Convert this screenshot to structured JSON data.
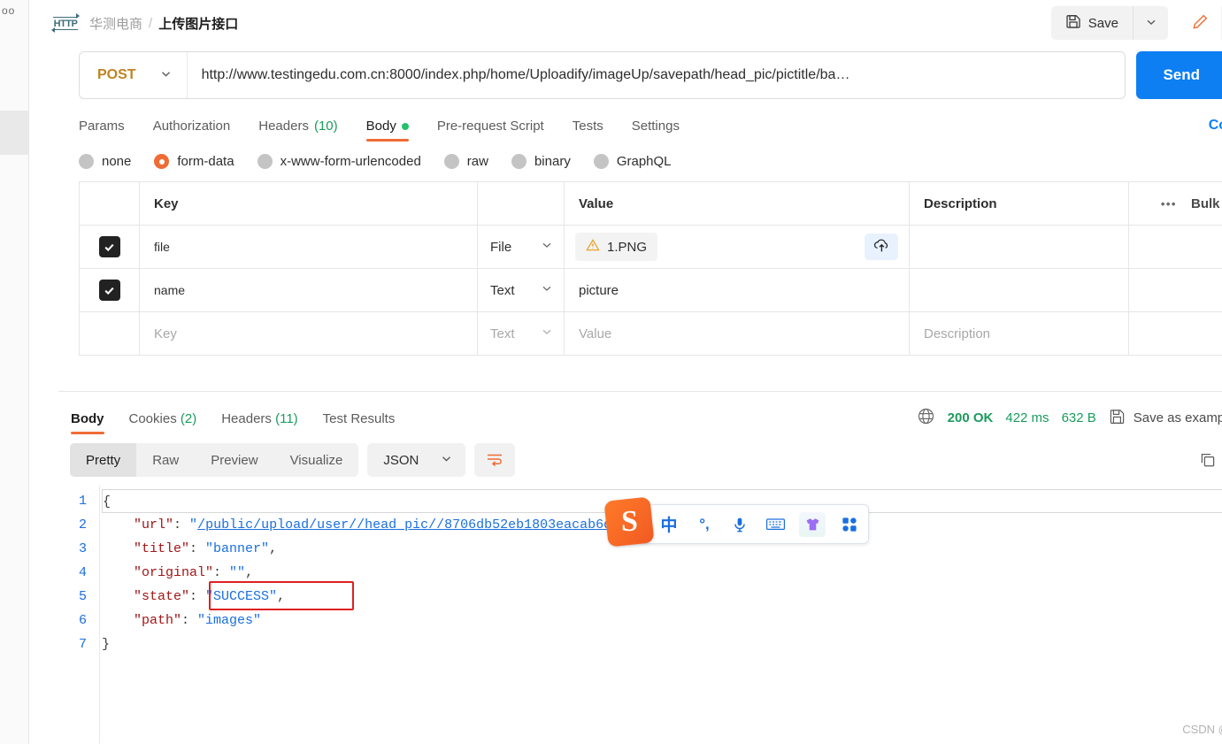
{
  "header": {
    "protocol_badge": "HTTP",
    "collection": "华测电商",
    "separator": "/",
    "request_name": "上传图片接口",
    "save_label": "Save",
    "icons": {
      "save": "floppy-disk-icon",
      "save_caret": "chevron-down-icon",
      "edit": "pencil-icon",
      "comment": "comment-icon"
    }
  },
  "urlbar": {
    "method": "POST",
    "url": "http://www.testingedu.com.cn:8000/index.php/home/Uploadify/imageUp/savepath/head_pic/pictitle/ba…",
    "send_label": "Send"
  },
  "request_tabs": [
    {
      "label": "Params",
      "count": "",
      "active": false,
      "dot": false
    },
    {
      "label": "Authorization",
      "count": "",
      "active": false,
      "dot": false
    },
    {
      "label": "Headers",
      "count": "(10)",
      "active": false,
      "dot": false
    },
    {
      "label": "Body",
      "count": "",
      "active": true,
      "dot": true
    },
    {
      "label": "Pre-request Script",
      "count": "",
      "active": false,
      "dot": false
    },
    {
      "label": "Tests",
      "count": "",
      "active": false,
      "dot": false
    },
    {
      "label": "Settings",
      "count": "",
      "active": false,
      "dot": false
    }
  ],
  "cookies_link": "Cookies",
  "body_types": [
    {
      "label": "none",
      "selected": false
    },
    {
      "label": "form-data",
      "selected": true
    },
    {
      "label": "x-www-form-urlencoded",
      "selected": false
    },
    {
      "label": "raw",
      "selected": false
    },
    {
      "label": "binary",
      "selected": false
    },
    {
      "label": "GraphQL",
      "selected": false
    }
  ],
  "form_table": {
    "headers": {
      "key": "Key",
      "value": "Value",
      "description": "Description",
      "bulk_edit": "Bulk Edit",
      "more": "•••"
    },
    "rows": [
      {
        "checked": true,
        "key": "file",
        "type": "File",
        "value": "1.PNG",
        "value_is_file": true,
        "description": "",
        "has_upload": true
      },
      {
        "checked": true,
        "key": "name",
        "type": "Text",
        "value": "picture",
        "value_is_file": false,
        "description": "",
        "has_upload": false
      }
    ],
    "placeholder_row": {
      "key": "Key",
      "type": "Text",
      "value": "Value",
      "description": "Description"
    }
  },
  "response": {
    "tabs": [
      {
        "label": "Body",
        "count": "",
        "active": true
      },
      {
        "label": "Cookies",
        "count": "(2)",
        "active": false
      },
      {
        "label": "Headers",
        "count": "(11)",
        "active": false
      },
      {
        "label": "Test Results",
        "count": "",
        "active": false
      }
    ],
    "status_code": "200 OK",
    "time": "422 ms",
    "size": "632 B",
    "save_as_example": "Save as example",
    "more": "•••",
    "view_modes": [
      {
        "label": "Pretty",
        "active": true
      },
      {
        "label": "Raw",
        "active": false
      },
      {
        "label": "Preview",
        "active": false
      },
      {
        "label": "Visualize",
        "active": false
      }
    ],
    "format": "JSON",
    "body_lines": [
      {
        "num": "1",
        "segments": [
          {
            "t": "{",
            "c": "p"
          }
        ]
      },
      {
        "num": "2",
        "segments": [
          {
            "t": "    ",
            "c": "p"
          },
          {
            "t": "\"url\"",
            "c": "k"
          },
          {
            "t": ": ",
            "c": "p"
          },
          {
            "t": "\"",
            "c": "s"
          },
          {
            "t": "/public/upload/user//head_pic//8706db52eb1803eacab6d180b6a73fe2.PNG",
            "c": "link"
          },
          {
            "t": "\"",
            "c": "s"
          },
          {
            "t": ",",
            "c": "p"
          }
        ]
      },
      {
        "num": "3",
        "segments": [
          {
            "t": "    ",
            "c": "p"
          },
          {
            "t": "\"title\"",
            "c": "k"
          },
          {
            "t": ": ",
            "c": "p"
          },
          {
            "t": "\"banner\"",
            "c": "s"
          },
          {
            "t": ",",
            "c": "p"
          }
        ]
      },
      {
        "num": "4",
        "segments": [
          {
            "t": "    ",
            "c": "p"
          },
          {
            "t": "\"original\"",
            "c": "k"
          },
          {
            "t": ": ",
            "c": "p"
          },
          {
            "t": "\"\"",
            "c": "s"
          },
          {
            "t": ",",
            "c": "p"
          }
        ]
      },
      {
        "num": "5",
        "segments": [
          {
            "t": "    ",
            "c": "p"
          },
          {
            "t": "\"state\"",
            "c": "k"
          },
          {
            "t": ": ",
            "c": "p"
          },
          {
            "t": "\"SUCCESS\"",
            "c": "s"
          },
          {
            "t": ",",
            "c": "p"
          }
        ],
        "highlight": true
      },
      {
        "num": "6",
        "segments": [
          {
            "t": "    ",
            "c": "p"
          },
          {
            "t": "\"path\"",
            "c": "k"
          },
          {
            "t": ": ",
            "c": "p"
          },
          {
            "t": "\"images\"",
            "c": "s"
          }
        ]
      },
      {
        "num": "7",
        "segments": [
          {
            "t": "}",
            "c": "p"
          }
        ]
      }
    ]
  },
  "ime": {
    "logo": "S",
    "items": [
      {
        "name": "chinese-mode-icon",
        "glyph": "中"
      },
      {
        "name": "punctuation-icon",
        "glyph": "°,"
      },
      {
        "name": "microphone-icon",
        "glyph": ""
      },
      {
        "name": "soft-keyboard-icon",
        "glyph": ""
      },
      {
        "name": "skin-icon",
        "glyph": ""
      },
      {
        "name": "toolbox-icon",
        "glyph": ""
      }
    ]
  },
  "right_rail": [
    {
      "name": "documentation-icon"
    },
    {
      "name": "comment-icon"
    },
    {
      "name": "code-icon"
    },
    {
      "name": "mock-lightbulb-icon"
    },
    {
      "name": "info-icon"
    }
  ],
  "watermark": "CSDN @简丹**",
  "colors": {
    "accent_orange": "#ef6c35",
    "send_blue": "#0d7ff2",
    "method_amber": "#c0841f",
    "success_green": "#1a9b5c",
    "highlight_red": "#e02020"
  }
}
